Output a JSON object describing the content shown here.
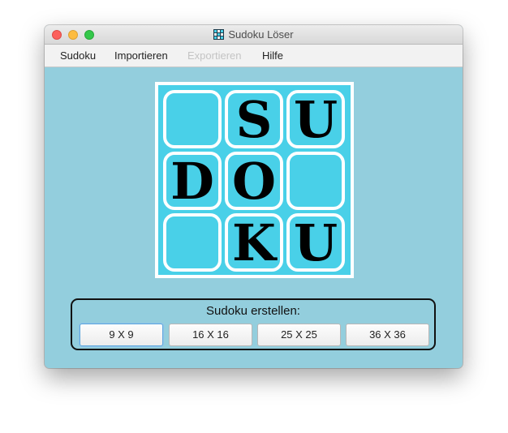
{
  "window": {
    "title": "Sudoku Löser",
    "app_icon": "sudoku-grid-icon"
  },
  "menu": {
    "items": [
      {
        "label": "Sudoku",
        "enabled": true
      },
      {
        "label": "Importieren",
        "enabled": true
      },
      {
        "label": "Exportieren",
        "enabled": false
      },
      {
        "label": "Hilfe",
        "enabled": true
      }
    ]
  },
  "logo": {
    "letters": [
      "",
      "S",
      "U",
      "D",
      "O",
      "",
      "",
      "K",
      "U"
    ],
    "background_color": "#49d0e8"
  },
  "create_panel": {
    "title": "Sudoku erstellen:",
    "buttons": [
      "9 X 9",
      "16 X 16",
      "25 X 25",
      "36 X 36"
    ]
  },
  "colors": {
    "window_background": "#93cedd",
    "focus_ring": "#5ea7dc"
  }
}
